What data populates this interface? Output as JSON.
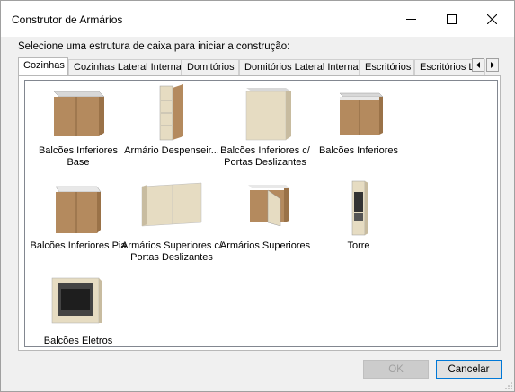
{
  "window": {
    "title": "Construtor de Armários"
  },
  "prompt": "Selecione uma estrutura de caixa para iniciar a construção:",
  "tabs": [
    {
      "label": "Cozinhas",
      "active": true
    },
    {
      "label": "Cozinhas Lateral Interna",
      "active": false
    },
    {
      "label": "Domitórios",
      "active": false
    },
    {
      "label": "Domitórios Lateral Interna",
      "active": false
    },
    {
      "label": "Escritórios",
      "active": false
    },
    {
      "label": "Escritórios L",
      "active": false
    }
  ],
  "items": [
    {
      "label": "Balcões Inferiores Base",
      "icon": "base-cabinet-icon"
    },
    {
      "label": "Armário Despenseir...",
      "icon": "pantry-cabinet-icon"
    },
    {
      "label": "Balcões Inferiores c/ Portas Deslizantes",
      "icon": "sliding-door-cabinet-icon"
    },
    {
      "label": "Balcões Inferiores",
      "icon": "lower-cabinet-icon"
    },
    {
      "label": "Balcões Inferiores Pia",
      "icon": "sink-cabinet-icon"
    },
    {
      "label": "Armários Superiores c/ Portas Deslizantes",
      "icon": "upper-sliding-cabinet-icon"
    },
    {
      "label": "Armários Superiores",
      "icon": "upper-cabinet-icon"
    },
    {
      "label": "Torre",
      "icon": "tower-cabinet-icon"
    },
    {
      "label": "Balcões Eletros",
      "icon": "appliance-cabinet-icon"
    }
  ],
  "buttons": {
    "ok": "OK",
    "cancel": "Cancelar"
  },
  "colors": {
    "wood": "#b48a5e",
    "cream": "#e6dcc2",
    "accent": "#0078d7"
  }
}
